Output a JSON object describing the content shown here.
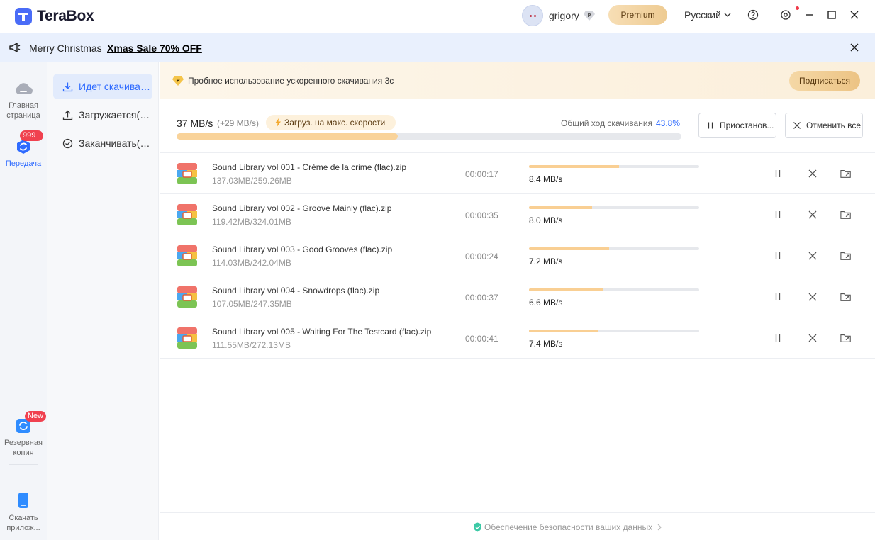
{
  "app": {
    "name": "TeraBox"
  },
  "header": {
    "username": "grigory",
    "premium_label": "Premium",
    "language": "Русский"
  },
  "promo": {
    "text": "Merry Christmas",
    "link": "Xmas Sale 70% OFF"
  },
  "rail": {
    "home": "Главная страница",
    "transfer": "Передача",
    "transfer_badge": "999+",
    "backup": "Резервная копия",
    "backup_badge": "New",
    "download_app": "Скачать прилож..."
  },
  "subnav": {
    "items": [
      {
        "label": "Идет скачиван..."
      },
      {
        "label": "Загружается(9..."
      },
      {
        "label": "Заканчивать(9..."
      }
    ]
  },
  "trial": {
    "text": "Пробное использование ускоренного скачивания 3с",
    "subscribe_label": "Подписаться"
  },
  "summary": {
    "speed": "37 MB/s",
    "speed_delta": "(+29 MB/s)",
    "boost_label": "Загруз. на макс. скорости",
    "overall_label": "Общий ход скачивания",
    "overall_pct": "43.8%",
    "overall_fraction": 0.438,
    "pause_all_label": "Приостанов...",
    "cancel_all_label": "Отменить все"
  },
  "downloads": [
    {
      "name": "Sound Library vol 001 - Crème de la crime (flac).zip",
      "size": "137.03MB/259.26MB",
      "time": "00:00:17",
      "speed": "8.4 MB/s",
      "progress": 0.529
    },
    {
      "name": "Sound Library vol 002 - Groove Mainly (flac).zip",
      "size": "119.42MB/324.01MB",
      "time": "00:00:35",
      "speed": "8.0 MB/s",
      "progress": 0.369
    },
    {
      "name": "Sound Library vol 003 - Good Grooves (flac).zip",
      "size": "114.03MB/242.04MB",
      "time": "00:00:24",
      "speed": "7.2 MB/s",
      "progress": 0.471
    },
    {
      "name": "Sound Library vol 004 - Snowdrops (flac).zip",
      "size": "107.05MB/247.35MB",
      "time": "00:00:37",
      "speed": "6.6 MB/s",
      "progress": 0.433
    },
    {
      "name": "Sound Library vol 005 - Waiting For The Testcard (flac).zip",
      "size": "111.55MB/272.13MB",
      "time": "00:00:41",
      "speed": "7.4 MB/s",
      "progress": 0.41
    }
  ],
  "footer": {
    "text": "Обеспечение безопасности ваших данных"
  },
  "colors": {
    "accent": "#2f6bff",
    "progress": "#f9cf93",
    "badge": "#f0414f"
  }
}
